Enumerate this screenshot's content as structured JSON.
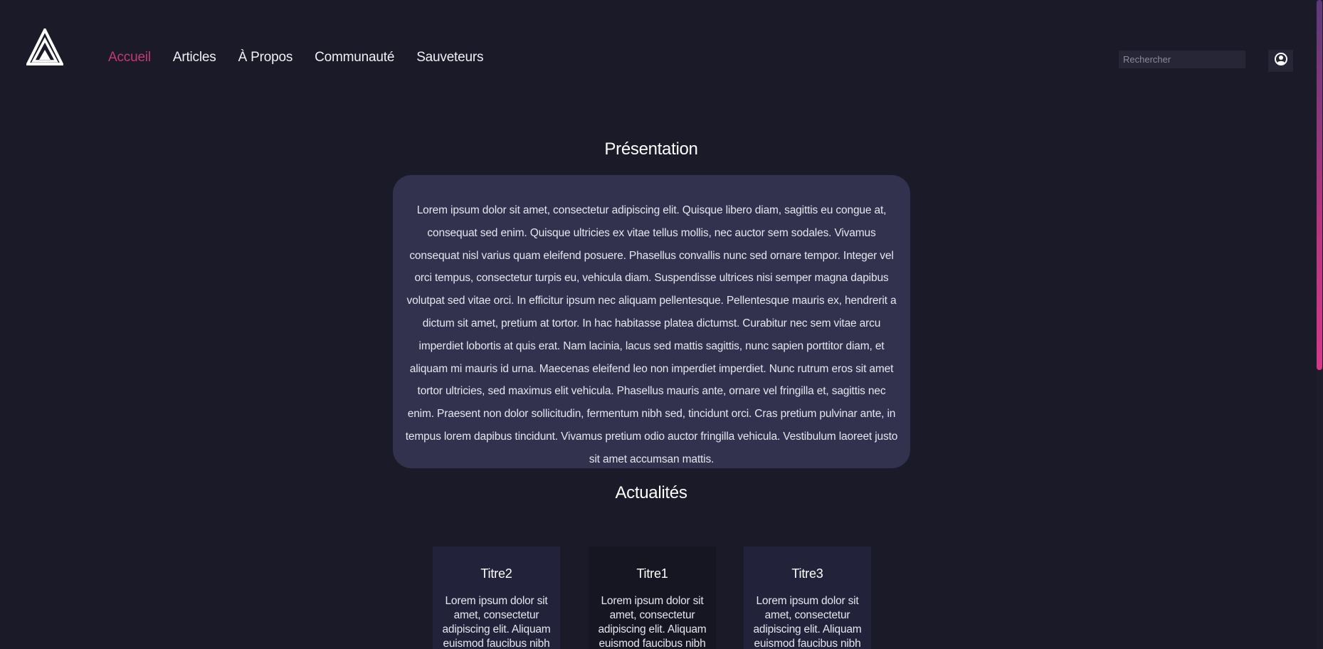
{
  "nav": {
    "items": [
      {
        "label": "Accueil",
        "active": true
      },
      {
        "label": "Articles",
        "active": false
      },
      {
        "label": "À Propos",
        "active": false
      },
      {
        "label": "Communauté",
        "active": false
      },
      {
        "label": "Sauveteurs",
        "active": false
      }
    ],
    "active_color": "#c2397a"
  },
  "search": {
    "placeholder": "Rechercher",
    "value": ""
  },
  "icons": {
    "logo": "triangle-logo-icon",
    "user": "user-avatar-icon"
  },
  "presentation": {
    "title": "Présentation",
    "text": "Lorem ipsum dolor sit amet, consectetur adipiscing elit. Quisque libero diam, sagittis eu congue at, consequat sed enim. Quisque ultricies ex vitae tellus mollis, nec auctor sem sodales. Vivamus consequat nisl varius quam eleifend posuere. Phasellus convallis nunc sed ornare tempor. Integer vel orci tempus, consectetur turpis eu, vehicula diam. Suspendisse ultrices nisi semper magna dapibus volutpat sed vitae orci. In efficitur ipsum nec aliquam pellentesque. Pellentesque mauris ex, hendrerit a dictum sit amet, pretium at tortor. In hac habitasse platea dictumst. Curabitur nec sem vitae arcu imperdiet lobortis at quis erat. Nam lacinia, lacus sed mattis sagittis, nunc sapien porttitor diam, et aliquam mi mauris id urna. Maecenas eleifend leo non imperdiet imperdiet. Nunc rutrum eros sit amet tortor ultricies, sed maximus elit vehicula. Phasellus mauris ante, ornare vel fringilla et, sagittis nec enim. Praesent non dolor sollicitudin, fermentum nibh sed, tincidunt orci. Cras pretium pulvinar ante, in tempus lorem dapibus tincidunt. Vivamus pretium odio auctor fringilla vehicula. Vestibulum laoreet justo sit amet accumsan mattis."
  },
  "news": {
    "title": "Actualités",
    "cards": [
      {
        "title": "Titre2",
        "text": "Lorem ipsum dolor sit amet, consectetur adipiscing elit. Aliquam euismod faucibus nibh"
      },
      {
        "title": "Titre1",
        "text": "Lorem ipsum dolor sit amet, consectetur adipiscing elit. Aliquam euismod faucibus nibh"
      },
      {
        "title": "Titre3",
        "text": "Lorem ipsum dolor sit amet, consectetur adipiscing elit. Aliquam euismod faucibus nibh"
      }
    ]
  },
  "colors": {
    "background": "#1a1a29",
    "card": "#32324f",
    "accent": "#c2397a"
  }
}
